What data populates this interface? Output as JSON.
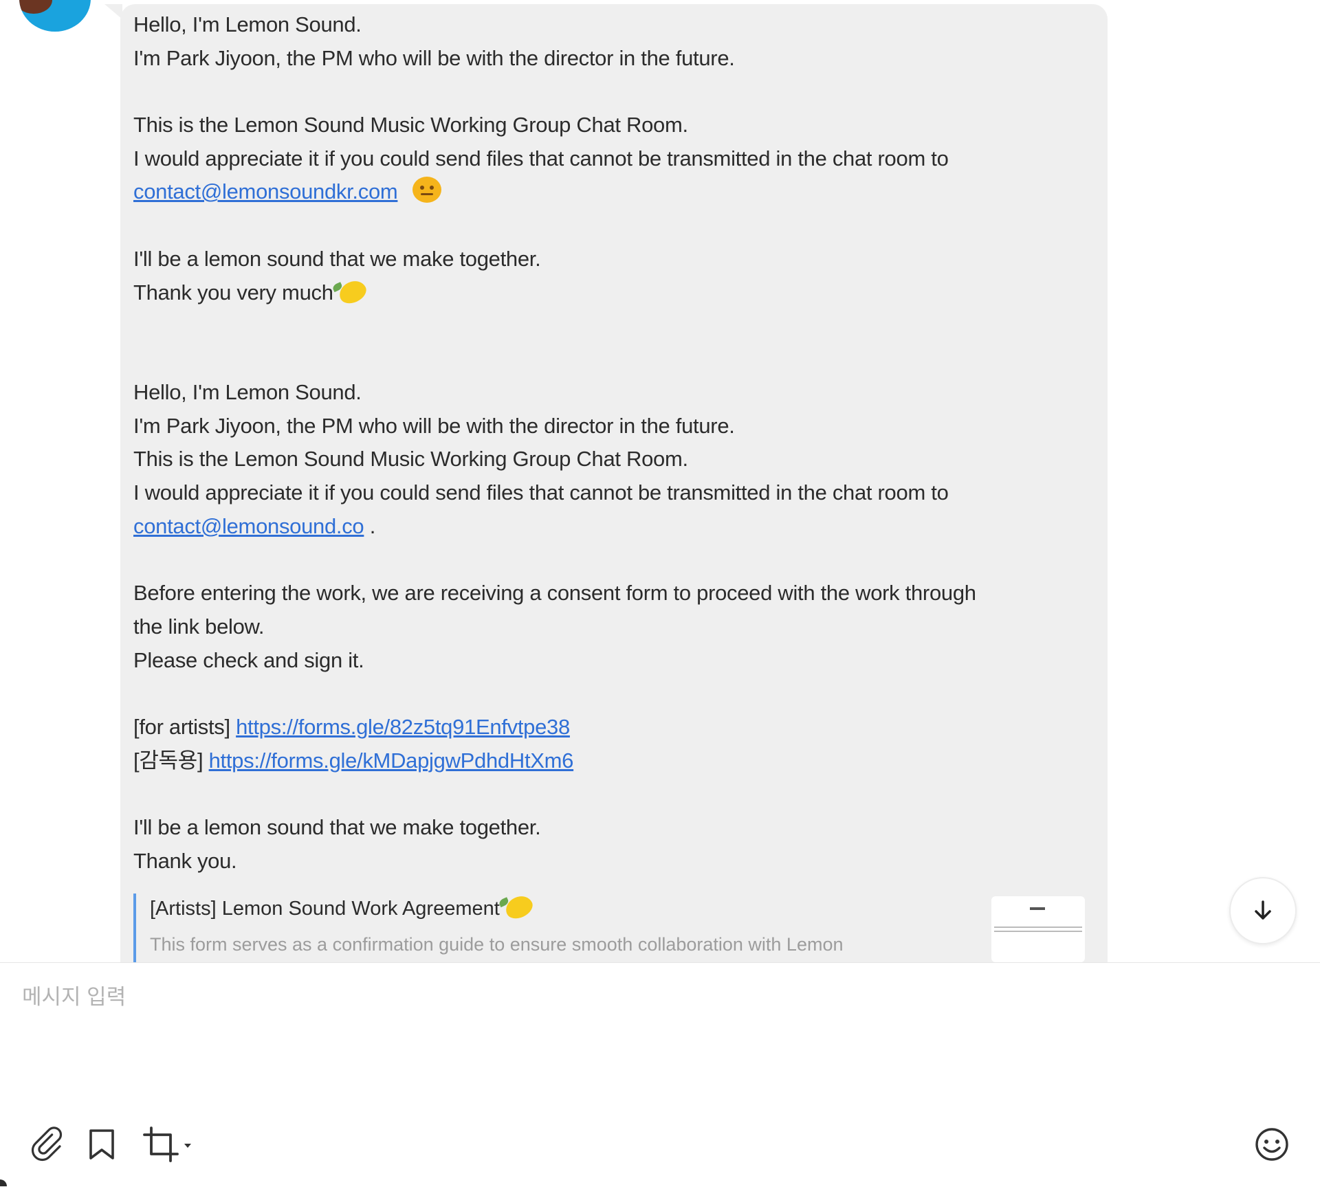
{
  "messages": [
    {
      "lines": [
        {
          "text": "Hello, I'm Lemon Sound."
        },
        {
          "text": "I'm Park Jiyoon, the PM who will be with the director in the future."
        },
        {
          "blank": true
        },
        {
          "text": "This is the Lemon Sound Music Working Group Chat Room."
        },
        {
          "text": "I would appreciate it if you could send files that cannot be transmitted in the chat room to"
        },
        {
          "link": "contact@lemonsoundkr.com",
          "emoji": "slight-smile-emoji"
        },
        {
          "blank": true
        },
        {
          "text": "I'll be a lemon sound that we make together."
        },
        {
          "text": "Thank you very much",
          "emoji": "lemon-emoji"
        },
        {
          "blank": true
        },
        {
          "blank": true
        }
      ]
    },
    {
      "lines": [
        {
          "text": "Hello, I'm Lemon Sound."
        },
        {
          "text": "I'm Park Jiyoon, the PM who will be with the director in the future."
        },
        {
          "text": "This is the Lemon Sound Music Working Group Chat Room."
        },
        {
          "text": "I would appreciate it if you could send files that cannot be transmitted in the chat room to"
        },
        {
          "link": "contact@lemonsound.co",
          "suffix": " ."
        },
        {
          "blank": true
        },
        {
          "text": "Before entering the work, we are receiving a consent form to proceed with the work through"
        },
        {
          "text": "the link below."
        },
        {
          "text": "Please check and sign it."
        },
        {
          "blank": true
        },
        {
          "prefix": "[for artists] ",
          "link": "https://forms.gle/82z5tq91Enfvtpe38"
        },
        {
          "prefix": "[감독용] ",
          "link": "https://forms.gle/kMDapjgwPdhdHtXm6"
        },
        {
          "blank": true
        },
        {
          "text": "I'll be a lemon sound that we make together."
        },
        {
          "text": "Thank you."
        }
      ]
    }
  ],
  "link_preview": {
    "title": "[Artists] Lemon Sound Work Agreement",
    "title_emoji": "lemon-emoji",
    "description": "This form serves as a confirmation guide to ensure smooth collaboration with Lemon"
  },
  "composer": {
    "placeholder": "메시지 입력",
    "value": ""
  },
  "icons": {
    "attach": "paperclip-icon",
    "bookmark": "bookmark-icon",
    "capture": "crop-capture-icon",
    "emoji": "smiley-icon",
    "scroll": "arrow-down-icon"
  },
  "colors": {
    "bubble": "#efefef",
    "link": "#2f6fd6",
    "avatar": "#1aa3de",
    "placeholder": "#b3b3b3"
  }
}
